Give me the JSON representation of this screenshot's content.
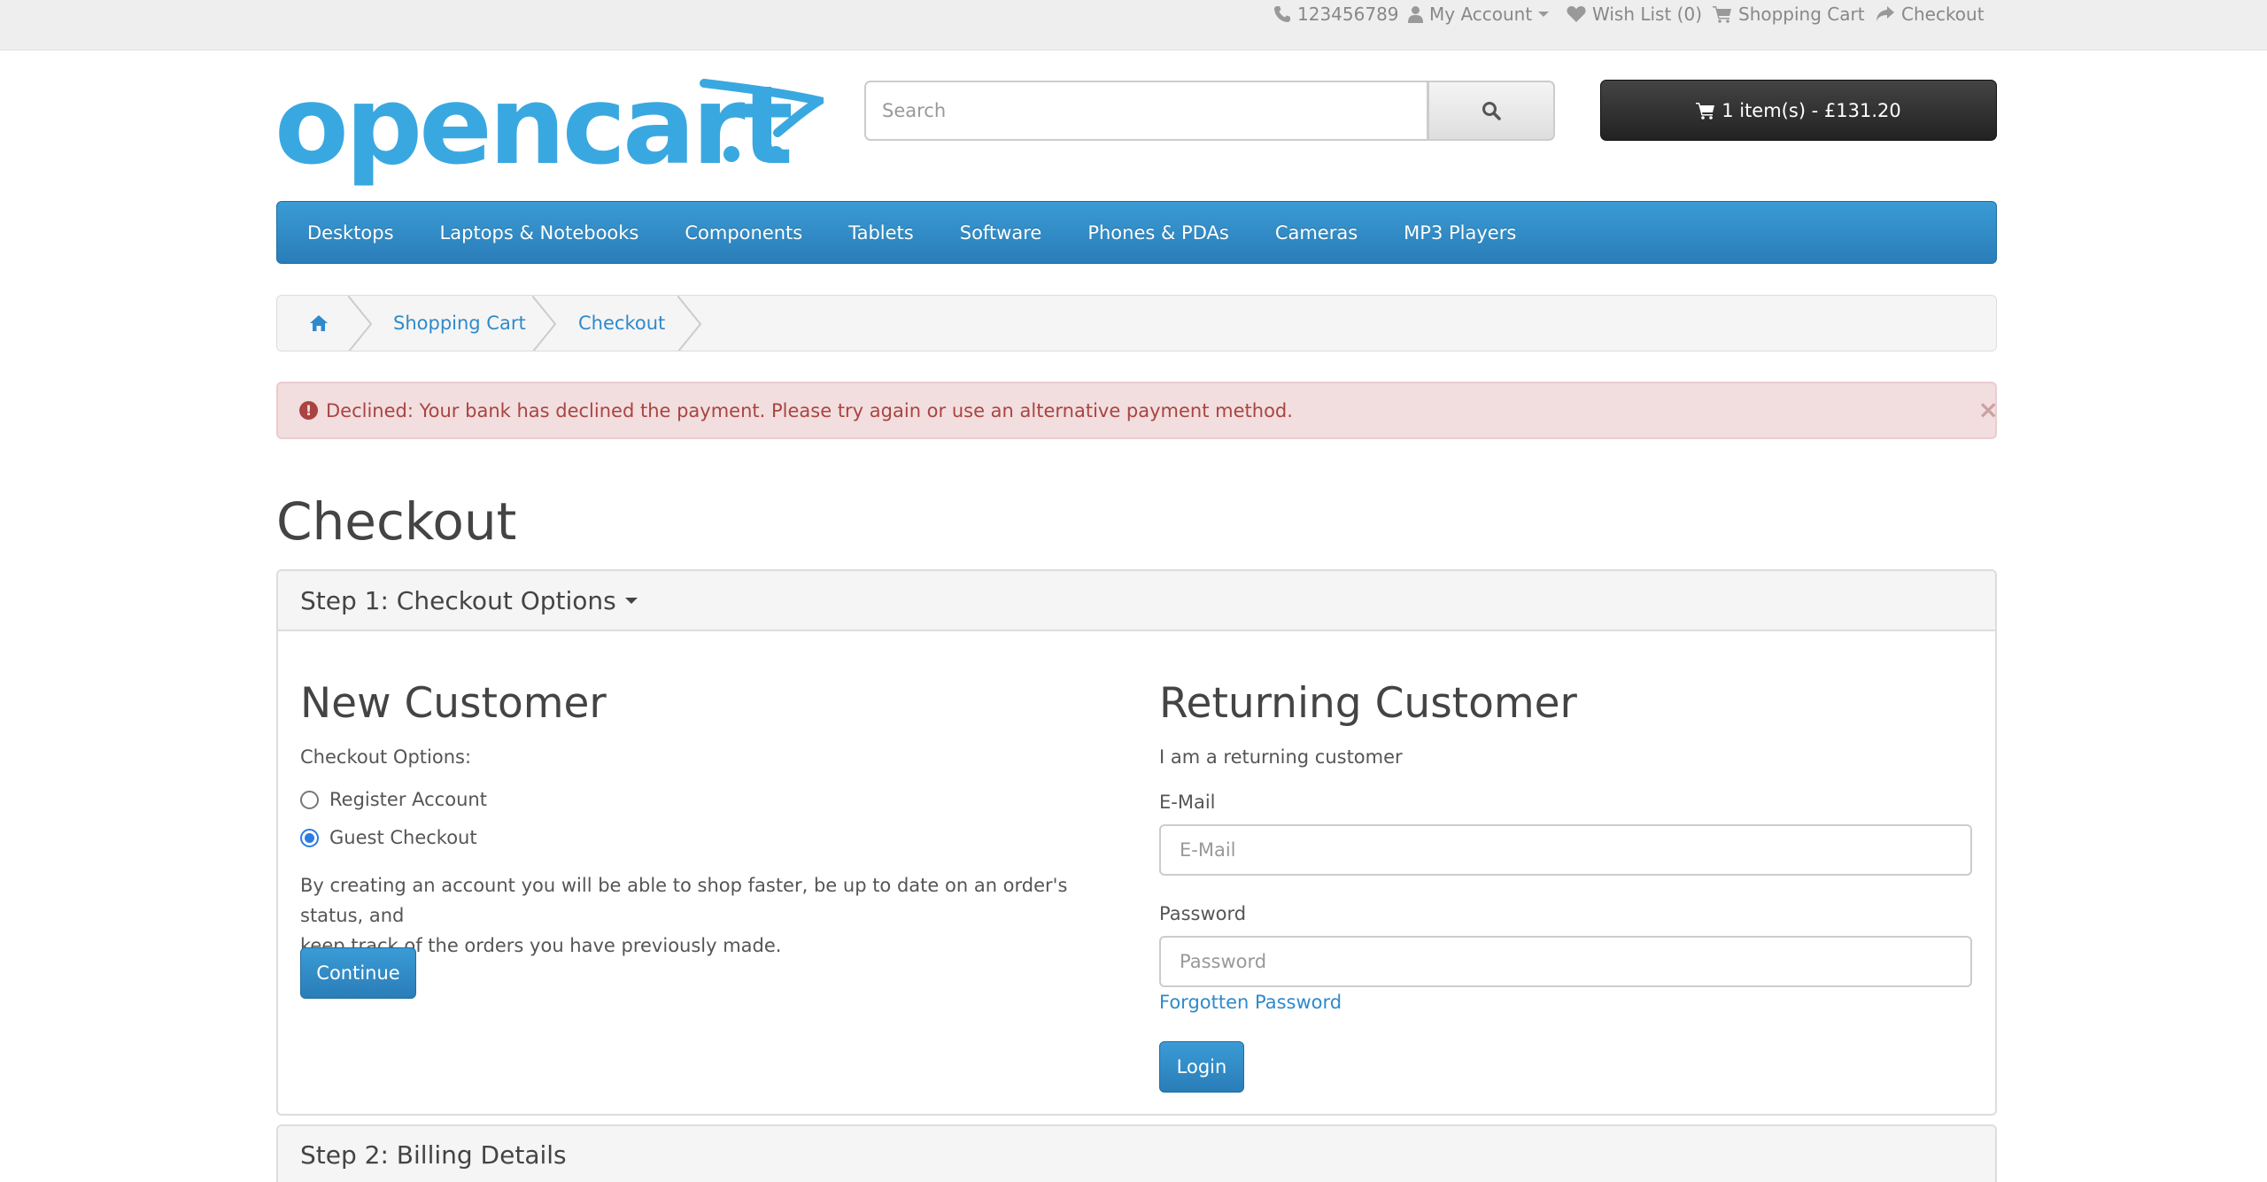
{
  "topbar": {
    "phone": "123456789",
    "my_account": "My Account",
    "wish_list": "Wish List (0)",
    "shopping_cart": "Shopping Cart",
    "checkout": "Checkout"
  },
  "header": {
    "logo_text": "opencart",
    "search_placeholder": "Search",
    "cart_label": "1 item(s) - £131.20"
  },
  "nav": {
    "items": [
      "Desktops",
      "Laptops & Notebooks",
      "Components",
      "Tablets",
      "Software",
      "Phones & PDAs",
      "Cameras",
      "MP3 Players"
    ]
  },
  "breadcrumb": {
    "items": [
      "Shopping Cart",
      "Checkout"
    ]
  },
  "alert": {
    "message": "Declined: Your bank has declined the payment. Please try again or use an alternative payment method.",
    "close": "×"
  },
  "page": {
    "title": "Checkout"
  },
  "step1": {
    "heading": "Step 1: Checkout Options",
    "new_customer": {
      "title": "New Customer",
      "options_label": "Checkout Options:",
      "register_label": "Register Account",
      "guest_label": "Guest Checkout",
      "selected": "Guest Checkout",
      "description_line1": "By creating an account you will be able to shop faster, be up to date on an order's status, and",
      "description_line2": "keep track of the orders you have previously made.",
      "continue_label": "Continue"
    },
    "returning_customer": {
      "title": "Returning Customer",
      "subtitle": "I am a returning customer",
      "email_label": "E-Mail",
      "email_placeholder": "E-Mail",
      "password_label": "Password",
      "password_placeholder": "Password",
      "forgotten_label": "Forgotten Password",
      "login_label": "Login"
    }
  },
  "step2": {
    "heading": "Step 2: Billing Details"
  },
  "colors": {
    "primary": "#2a7db8",
    "logo": "#3aa8e0",
    "alert_bg": "#f2dede",
    "alert_text": "#a94442"
  }
}
